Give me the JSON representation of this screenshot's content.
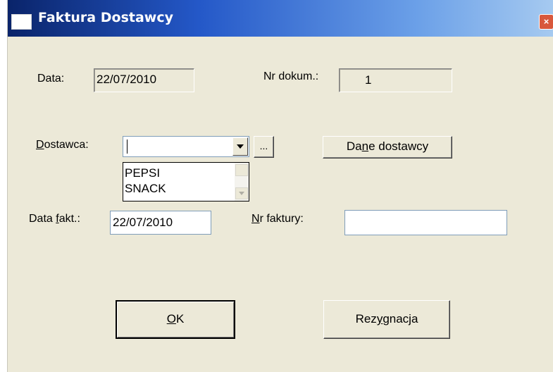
{
  "window": {
    "title": "Faktura Dostawcy",
    "close_glyph": "×"
  },
  "form": {
    "data_label": "Data:",
    "data_value": "22/07/2010",
    "nr_dokum_label": "Nr dokum.:",
    "nr_dokum_value": "1",
    "dostawca_label_accel": "D",
    "dostawca_label_rest": "ostawca:",
    "dostawca_value": "",
    "browse_label": "...",
    "dane_pre": "Da",
    "dane_accel": "n",
    "dane_post": "e dostawcy",
    "dostawca_options": [
      "PEPSI",
      "SNACK"
    ],
    "data_fakt_pre": "Data ",
    "data_fakt_accel": "f",
    "data_fakt_post": "akt.:",
    "data_fakt_value": "22/07/2010",
    "nr_faktury_accel": "N",
    "nr_faktury_rest": "r faktury:",
    "nr_faktury_value": ""
  },
  "buttons": {
    "ok_accel": "O",
    "ok_rest": "K",
    "cancel_pre": "Rez",
    "cancel_accel": "y",
    "cancel_post": "gnacja"
  }
}
